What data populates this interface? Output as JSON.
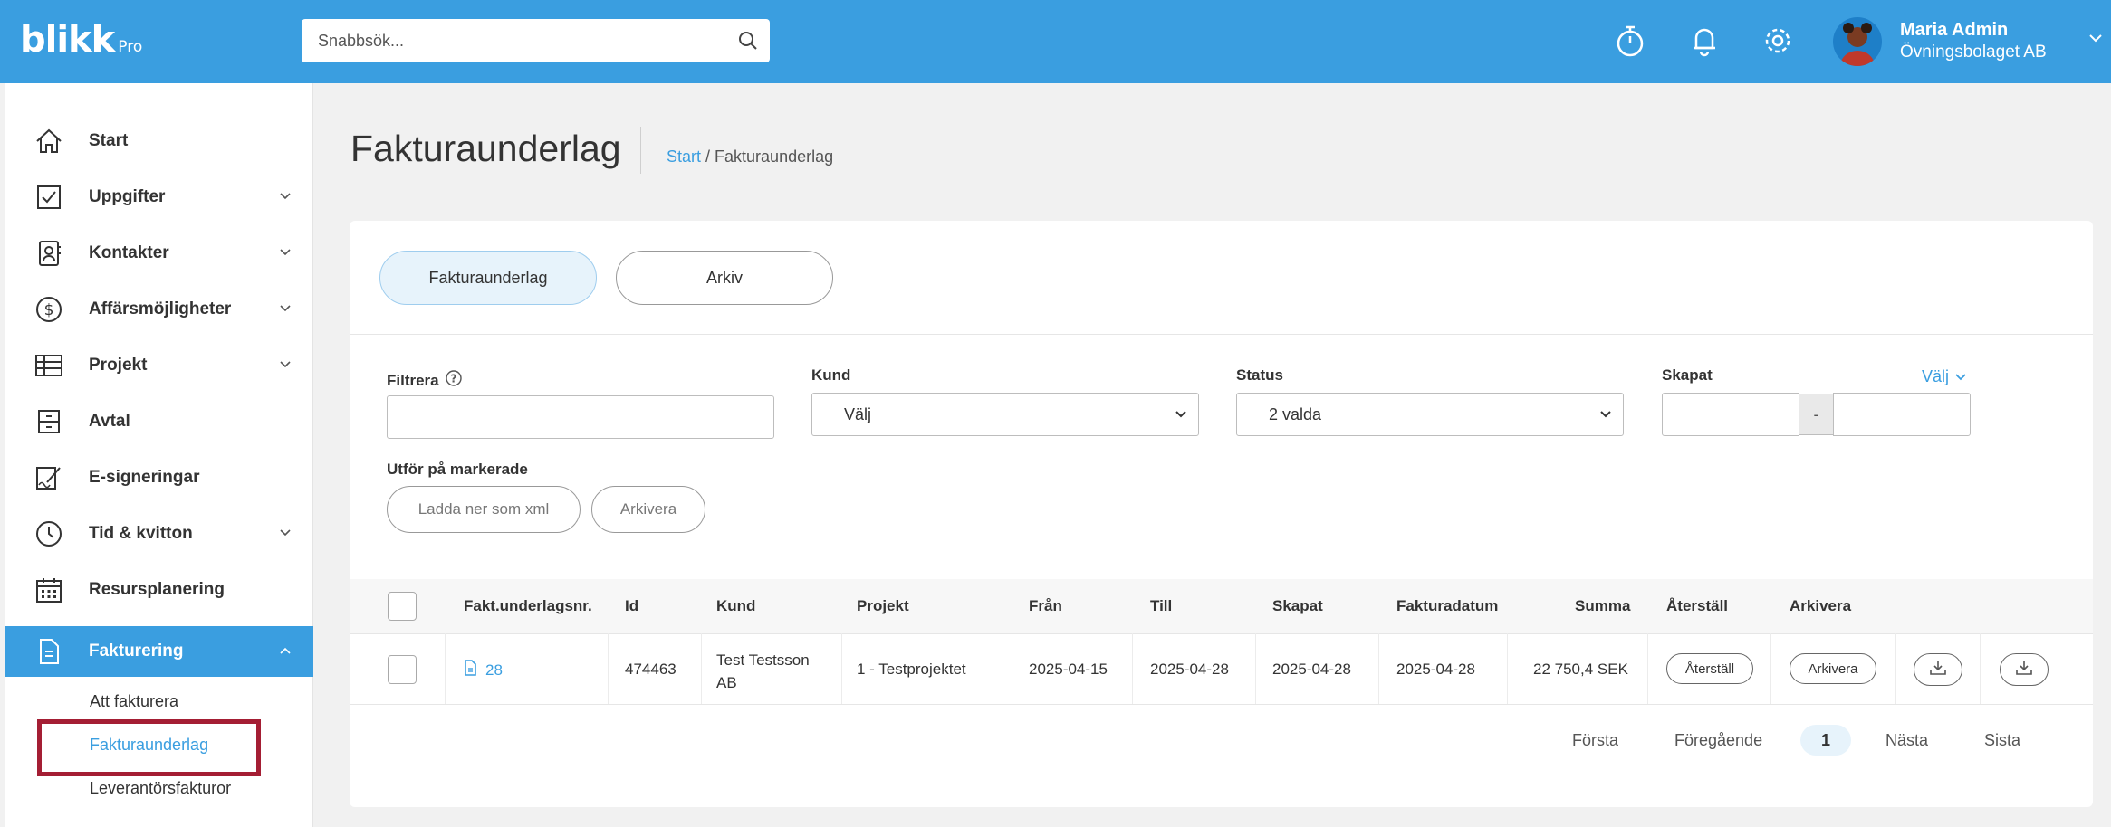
{
  "app": {
    "logo_text": "blikk",
    "logo_sub": "Pro",
    "search_placeholder": "Snabbsök...",
    "icons": [
      "stopwatch-icon",
      "bell-icon",
      "gear-icon"
    ],
    "user": {
      "name": "Maria Admin",
      "company": "Övningsbolaget AB"
    },
    "accent": "#3a9ee0"
  },
  "sidebar": {
    "items": [
      {
        "label": "Start",
        "icon": "home-icon",
        "has_chevron": false
      },
      {
        "label": "Uppgifter",
        "icon": "checkbox-icon",
        "has_chevron": true
      },
      {
        "label": "Kontakter",
        "icon": "contact-card-icon",
        "has_chevron": true
      },
      {
        "label": "Affärsmöjligheter",
        "icon": "dollar-icon",
        "has_chevron": true
      },
      {
        "label": "Projekt",
        "icon": "table-icon",
        "has_chevron": true
      },
      {
        "label": "Avtal",
        "icon": "archive-icon",
        "has_chevron": false
      },
      {
        "label": "E-signeringar",
        "icon": "signature-icon",
        "has_chevron": false
      },
      {
        "label": "Tid & kvitton",
        "icon": "clock-icon",
        "has_chevron": true
      },
      {
        "label": "Resursplanering",
        "icon": "calendar-icon",
        "has_chevron": false
      },
      {
        "label": "Fakturering",
        "icon": "document-icon",
        "has_chevron": true,
        "active": true
      }
    ],
    "sub_items": [
      {
        "label": "Att fakturera"
      },
      {
        "label": "Fakturaunderlag",
        "active": true
      },
      {
        "label": "Leverantörsfakturor"
      }
    ]
  },
  "page": {
    "title": "Fakturaunderlag",
    "breadcrumb": {
      "home": "Start",
      "separator": " / ",
      "current": "Fakturaunderlag"
    }
  },
  "tabs": [
    {
      "label": "Fakturaunderlag",
      "active": true
    },
    {
      "label": "Arkiv",
      "active": false
    }
  ],
  "filters": {
    "filter_label": "Filtrera",
    "filter_value": "",
    "customer_label": "Kund",
    "customer_value": "Välj",
    "status_label": "Status",
    "status_value": "2 valda",
    "created_label": "Skapat",
    "created_choose": "Välj",
    "date_separator": "-",
    "bulk_label": "Utför på markerade",
    "bulk_actions": [
      "Ladda ner som xml",
      "Arkivera"
    ]
  },
  "table": {
    "columns": [
      "Fakt.underlagsnr.",
      "Id",
      "Kund",
      "Projekt",
      "Från",
      "Till",
      "Skapat",
      "Fakturadatum",
      "Summa",
      "Återställ",
      "Arkivera"
    ],
    "rows": [
      {
        "number": "28",
        "id": "474463",
        "customer_line1": "Test Testsson",
        "customer_line2": "AB",
        "project": "1 - Testprojektet",
        "from": "2025-04-15",
        "to": "2025-04-28",
        "created": "2025-04-28",
        "invoice_date": "2025-04-28",
        "sum": "22 750,4 SEK",
        "restore_label": "Återställ",
        "archive_label": "Arkivera"
      }
    ]
  },
  "pagination": {
    "first": "Första",
    "prev": "Föregående",
    "current": "1",
    "next": "Nästa",
    "last": "Sista"
  }
}
